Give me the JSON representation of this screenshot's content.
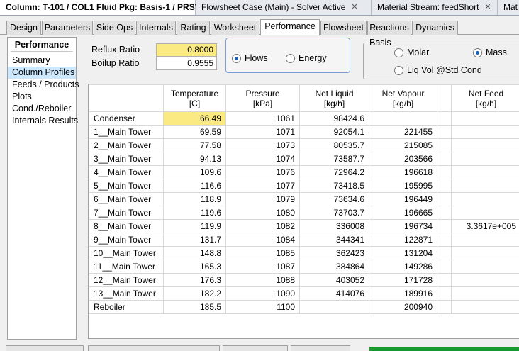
{
  "doc_tabs": [
    {
      "title": "Column: T-101 / COL1  Fluid Pkg: Basis-1 / PRSV",
      "close": "✕"
    },
    {
      "title": "Flowsheet Case (Main) - Solver Active",
      "close": "✕"
    },
    {
      "title": "Material Stream: feedShort",
      "close": "✕"
    },
    {
      "title": "Mat",
      "close": ""
    }
  ],
  "page_tabs": [
    "Design",
    "Parameters",
    "Side Ops",
    "Internals",
    "Rating",
    "Worksheet",
    "Performance",
    "Flowsheet",
    "Reactions",
    "Dynamics"
  ],
  "active_page_tab": "Performance",
  "nav": {
    "header": "Performance",
    "items": [
      "Summary",
      "Column Profiles",
      "Feeds / Products",
      "Plots",
      "Cond./Reboiler",
      "Internals Results"
    ],
    "selected": "Column Profiles"
  },
  "ratios": {
    "reflux_label": "Reflux Ratio",
    "reflux_value": "0.8000",
    "boilup_label": "Boilup Ratio",
    "boilup_value": "0.9555"
  },
  "flow_mode": {
    "flows_label": "Flows",
    "energy_label": "Energy",
    "selected": "Flows"
  },
  "basis": {
    "legend": "Basis",
    "molar_label": "Molar",
    "mass_label": "Mass",
    "liqvol_label": "Liq Vol @Std Cond",
    "selected": "Mass"
  },
  "grid": {
    "columns": [
      {
        "name": "Temperature",
        "unit": "[C]"
      },
      {
        "name": "Pressure",
        "unit": "[kPa]"
      },
      {
        "name": "Net Liquid",
        "unit": "[kg/h]"
      },
      {
        "name": "Net Vapour",
        "unit": "[kg/h]"
      },
      {
        "name": "",
        "unit": ""
      },
      {
        "name": "Net Feed",
        "unit": "[kg/h]"
      }
    ],
    "rows": [
      {
        "stage": "Condenser",
        "temperature": "66.49",
        "pressure": "1061",
        "net_liquid": "98424.6",
        "net_vapour": "",
        "net_feed": ""
      },
      {
        "stage": "1__Main Tower",
        "temperature": "69.59",
        "pressure": "1071",
        "net_liquid": "92054.1",
        "net_vapour": "221455",
        "net_feed": ""
      },
      {
        "stage": "2__Main Tower",
        "temperature": "77.58",
        "pressure": "1073",
        "net_liquid": "80535.7",
        "net_vapour": "215085",
        "net_feed": ""
      },
      {
        "stage": "3__Main Tower",
        "temperature": "94.13",
        "pressure": "1074",
        "net_liquid": "73587.7",
        "net_vapour": "203566",
        "net_feed": ""
      },
      {
        "stage": "4__Main Tower",
        "temperature": "109.6",
        "pressure": "1076",
        "net_liquid": "72964.2",
        "net_vapour": "196618",
        "net_feed": ""
      },
      {
        "stage": "5__Main Tower",
        "temperature": "116.6",
        "pressure": "1077",
        "net_liquid": "73418.5",
        "net_vapour": "195995",
        "net_feed": ""
      },
      {
        "stage": "6__Main Tower",
        "temperature": "118.9",
        "pressure": "1079",
        "net_liquid": "73634.6",
        "net_vapour": "196449",
        "net_feed": ""
      },
      {
        "stage": "7__Main Tower",
        "temperature": "119.6",
        "pressure": "1080",
        "net_liquid": "73703.7",
        "net_vapour": "196665",
        "net_feed": ""
      },
      {
        "stage": "8__Main Tower",
        "temperature": "119.9",
        "pressure": "1082",
        "net_liquid": "336008",
        "net_vapour": "196734",
        "net_feed": "3.3617e+005"
      },
      {
        "stage": "9__Main Tower",
        "temperature": "131.7",
        "pressure": "1084",
        "net_liquid": "344341",
        "net_vapour": "122871",
        "net_feed": ""
      },
      {
        "stage": "10__Main Tower",
        "temperature": "148.8",
        "pressure": "1085",
        "net_liquid": "362423",
        "net_vapour": "131204",
        "net_feed": ""
      },
      {
        "stage": "11__Main Tower",
        "temperature": "165.3",
        "pressure": "1087",
        "net_liquid": "384864",
        "net_vapour": "149286",
        "net_feed": ""
      },
      {
        "stage": "12__Main Tower",
        "temperature": "176.3",
        "pressure": "1088",
        "net_liquid": "403052",
        "net_vapour": "171728",
        "net_feed": ""
      },
      {
        "stage": "13__Main Tower",
        "temperature": "182.2",
        "pressure": "1090",
        "net_liquid": "414076",
        "net_vapour": "189916",
        "net_feed": ""
      },
      {
        "stage": "Reboiler",
        "temperature": "185.5",
        "pressure": "1100",
        "net_liquid": "",
        "net_vapour": "200940",
        "net_feed": ""
      }
    ]
  },
  "colors": {
    "highlight_yellow": "#fbe982",
    "selected_nav": "#cce8ff",
    "radio_accent": "#1a5fb4",
    "status_green": "#1a9a2e"
  }
}
